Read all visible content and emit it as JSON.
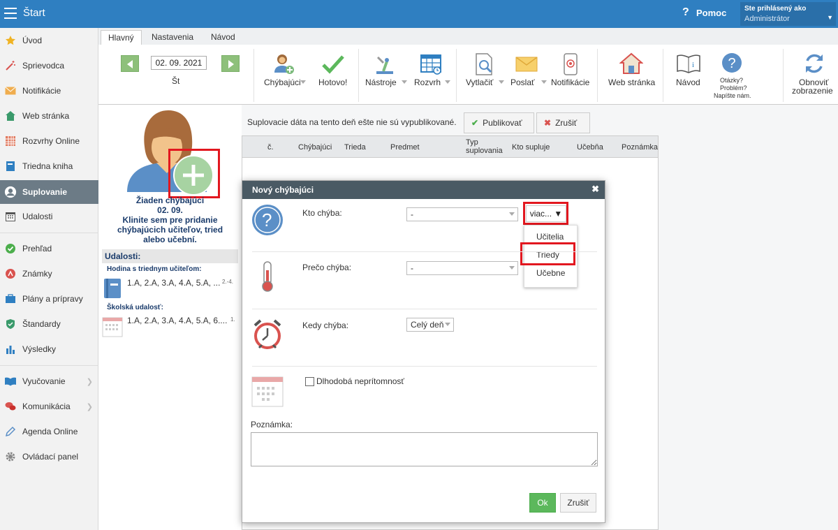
{
  "topbar": {
    "title": "Štart",
    "help_label": "Pomoc",
    "user_line1": "Ste prihlásený ako",
    "user_line2": "Administrátor"
  },
  "sidebar": {
    "items": [
      {
        "label": "Úvod",
        "icon": "star-icon"
      },
      {
        "label": "Sprievodca",
        "icon": "wand-icon"
      },
      {
        "label": "Notifikácie",
        "icon": "envelope-icon"
      },
      {
        "label": "Web stránka",
        "icon": "house-icon"
      },
      {
        "label": "Rozvrhy Online",
        "icon": "timetable-icon"
      },
      {
        "label": "Triedna kniha",
        "icon": "book-icon"
      },
      {
        "label": "Suplovanie",
        "icon": "person-icon"
      },
      {
        "label": "Udalosti",
        "icon": "calendar-icon"
      },
      {
        "label": "Prehľad",
        "icon": "check-circle-icon"
      },
      {
        "label": "Známky",
        "icon": "grades-icon"
      },
      {
        "label": "Plány a prípravy",
        "icon": "briefcase-icon"
      },
      {
        "label": "Štandardy",
        "icon": "shield-icon"
      },
      {
        "label": "Výsledky",
        "icon": "bar-chart-icon"
      },
      {
        "label": "Vyučovanie",
        "icon": "open-book-icon"
      },
      {
        "label": "Komunikácia",
        "icon": "chat-icon"
      },
      {
        "label": "Agenda Online",
        "icon": "pencil-icon"
      },
      {
        "label": "Ovládací panel",
        "icon": "gear-icon"
      }
    ]
  },
  "tabs": [
    "Hlavný",
    "Nastavenia",
    "Návod"
  ],
  "ribbon": {
    "date": "02. 09. 2021",
    "weekday": "Št",
    "absent": "Chýbajúci",
    "done": "Hotovo!",
    "tools": "Nástroje",
    "schedule": "Rozvrh",
    "print": "Vytlačiť",
    "send": "Poslať",
    "notifications": "Notifikácie",
    "website": "Web stránka",
    "guide": "Návod",
    "questions_l1": "Otázky?",
    "questions_l2": "Problém?",
    "questions_l3": "Napíšte nám.",
    "refresh_l1": "Obnoviť",
    "refresh_l2": "zobrazenie"
  },
  "leftpanel": {
    "nobody_l1": "Žiaden chýbajúci",
    "nobody_l2": "02. 09.",
    "nobody_l3": "Klinite sem pre pridanie",
    "nobody_l4": "chýbajúcich učiteľov, tried",
    "nobody_l5": "alebo učební.",
    "events_title": "Udalosti:",
    "event1_header": "Hodina s triednym učiteľom:",
    "event1_text": "1.A, 2.A, 3.A, 4.A, 5.A, ...",
    "event1_small": "2.-4.",
    "event2_header": "Školská udalosť:",
    "event2_text": "1.A, 2.A, 3.A, 4.A, 5.A, 6....",
    "event2_small": "1."
  },
  "main": {
    "notice": "Suplovacie dáta na tento deň ešte nie sú vypublikované.",
    "publish": "Publikovať",
    "cancel": "Zrušiť",
    "columns": [
      "č.",
      "Chýbajúci",
      "Trieda",
      "Predmet",
      "Typ suplovania",
      "Kto supluje",
      "Učebňa",
      "Poznámka"
    ]
  },
  "modal": {
    "title": "Nový chýbajúci",
    "who_label": "Kto chýba:",
    "who_value": "-",
    "more_button": "viac...",
    "dropdown": [
      "Učitelia",
      "Triedy",
      "Učebne"
    ],
    "why_label": "Prečo chýba:",
    "why_value": "-",
    "when_label": "Kedy chýba:",
    "when_value": "Celý deň",
    "longterm_label": "Dlhodobá neprítomnosť",
    "note_label": "Poznámka:",
    "ok": "Ok",
    "cancel": "Zrušiť"
  }
}
